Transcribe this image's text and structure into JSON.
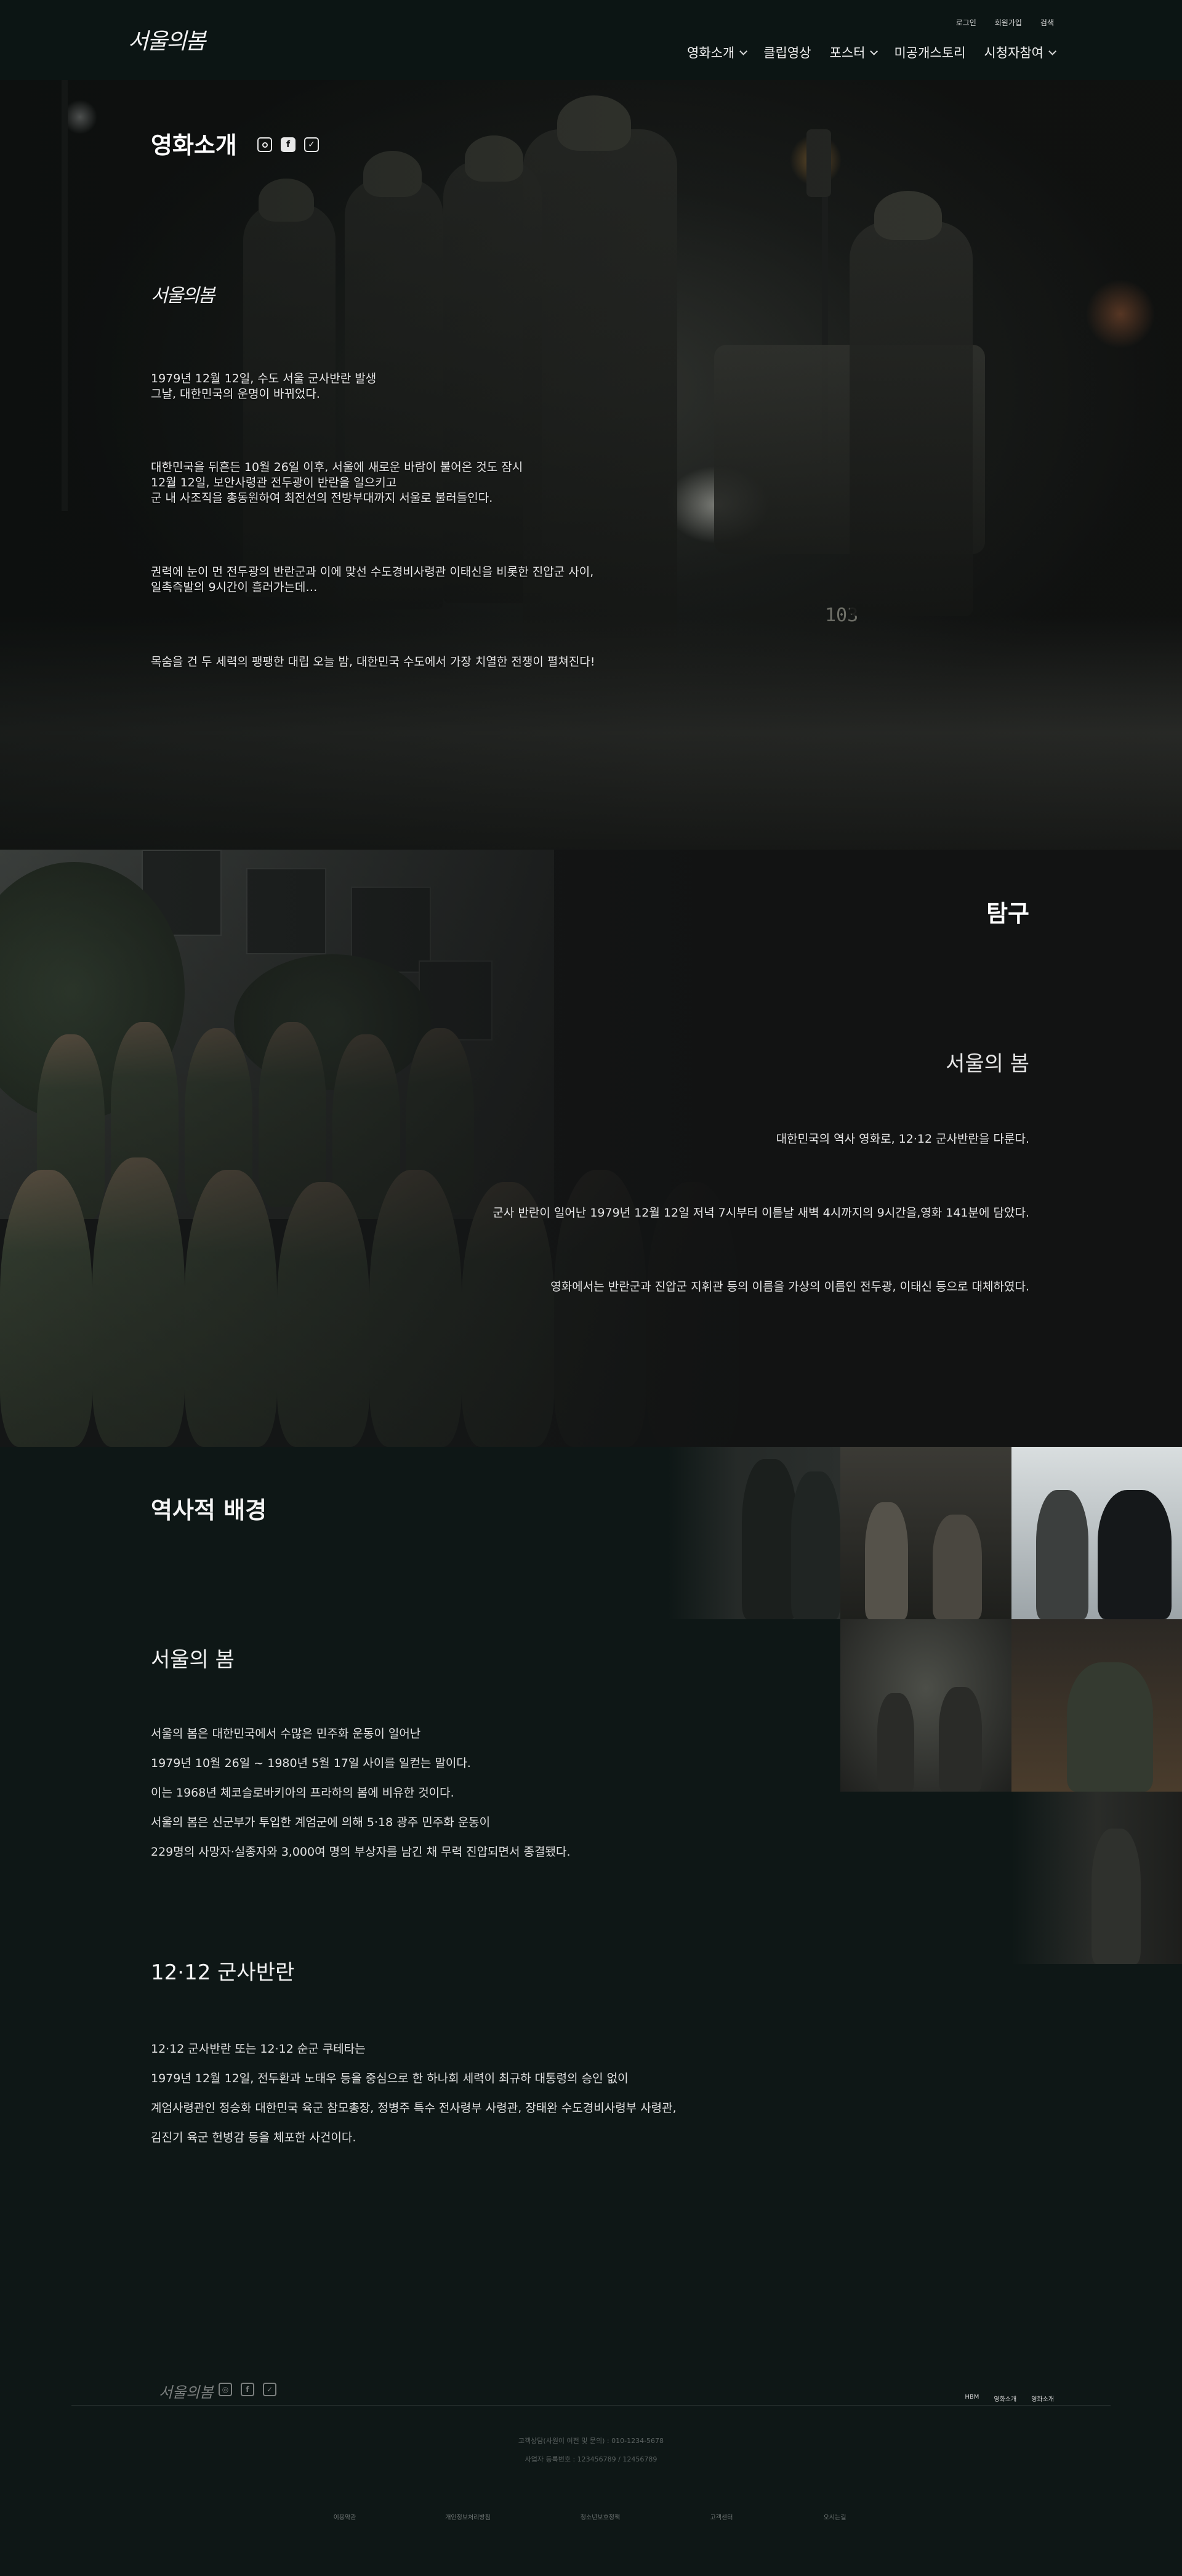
{
  "header": {
    "logo": "서울의봄",
    "util": [
      "로그인",
      "회원가입",
      "검색"
    ],
    "nav": [
      {
        "label": "영화소개",
        "dropdown": true
      },
      {
        "label": "클립영상",
        "dropdown": false
      },
      {
        "label": "포스터",
        "dropdown": true
      },
      {
        "label": "미공개스토리",
        "dropdown": false
      },
      {
        "label": "시청자참여",
        "dropdown": true
      }
    ]
  },
  "intro": {
    "title": "영화소개",
    "social": [
      "instagram-icon",
      "facebook-icon",
      "twitter-icon"
    ],
    "film_logo": "서울의봄",
    "p1_l1": "1979년 12월 12일, 수도 서울 군사반란 발생",
    "p1_l2": "그날, 대한민국의 운명이 바뀌었다.",
    "p2_l1": "대한민국을 뒤흔든 10월 26일 이후, 서울에 새로운 바람이 불어온 것도 잠시",
    "p2_l2": "12월 12일, 보안사령관 전두광이 반란을 일으키고",
    "p2_l3": "군 내 사조직을 총동원하여 최전선의 전방부대까지 서울로 불러들인다.",
    "p3_l1": "권력에 눈이 먼 전두광의 반란군과 이에 맞선 수도경비사령관 이태신을 비롯한 진압군 사이,",
    "p3_l2": "일촉즉발의 9시간이 흘러가는데…",
    "p4_l1": "목숨을 건 두 세력의 팽팽한 대립 오늘 밤, 대한민국 수도에서 가장 치열한 전쟁이 펼쳐진다!",
    "vehicle_number": "103"
  },
  "explore": {
    "title": "탐구",
    "subtitle": "서울의 봄",
    "p1": "대한민국의 역사 영화로, 12·12 군사반란을 다룬다.",
    "p2": "군사 반란이 일어난 1979년 12월 12일 저녁 7시부터 이튿날 새벽 4시까지의 9시간을,영화 141분에 담았다.",
    "p3": "영화에서는 반란군과 진압군 지휘관 등의 이름을 가상의 이름인 전두광, 이태신 등으로 대체하였다."
  },
  "history": {
    "title": "역사적 배경",
    "sub1": "서울의 봄",
    "sub1_lines": [
      "서울의 봄은 대한민국에서 수많은 민주화 운동이 일어난",
      "1979년 10월 26일 ~ 1980년 5월 17일 사이를 일컫는 말이다.",
      "이는 1968년 체코슬로바키아의 프라하의 봄에 비유한 것이다.",
      "서울의 봄은 신군부가 투입한 계엄군에 의해 5·18 광주 민주화 운동이",
      "229명의 사망자·실종자와 3,000여 명의 부상자를 남긴 채 무력 진압되면서 종결됐다."
    ],
    "sub2": "12·12 군사반란",
    "sub2_lines": [
      "12·12 군사반란 또는 12·12 순군 쿠테타는",
      "1979년 12월 12일, 전두환과 노태우 등을 중심으로 한 하나회 세력이 최규하 대통령의 승인 없이",
      "계엄사령관인 정승화 대한민국 육군 참모총장, 정병주 특수 전사령부 사령관, 장태완 수도경비사령부 사령관,",
      "김진기 육군 헌병감 등을 체포한 사건이다."
    ]
  },
  "footer": {
    "logo": "서울의봄",
    "links": [
      "HBM",
      "영화소개",
      "영화소개"
    ],
    "info1": "고객상담(사원이 여전 및 문의) : 010-1234-5678",
    "info2": "사업자 등록번호 : 123456789 / 12456789",
    "bottom": [
      "이용약관",
      "개인정보처리방침",
      "청소년보호정책",
      "고객센터",
      "오시는길"
    ]
  },
  "colors": {
    "background": "#0d1615",
    "text": "#e6e6e6"
  }
}
